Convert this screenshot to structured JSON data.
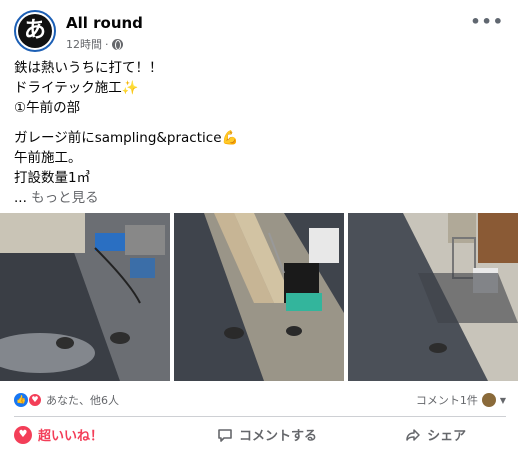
{
  "post": {
    "page_name": "All round",
    "avatar_char": "あ",
    "time": "12時間",
    "separator": "·",
    "more_icon": "more-horizontal-icon",
    "text_lines": [
      "鉄は熱いうちに打て！！",
      "ドライテック施工✨",
      "①午前の部",
      "ガレージ前にsampling&practice💪",
      "午前施工。",
      "打設数量1㎥"
    ],
    "see_more_prefix": "... ",
    "see_more": "もっと見る"
  },
  "reactions": {
    "summary": "あなた、他6人",
    "comments": "コメント1件"
  },
  "actions": {
    "love": "超いいね！",
    "comment": "コメントする",
    "share": "シェア"
  },
  "colors": {
    "love_red": "#f33e58",
    "like_blue": "#1877f2",
    "meta_gray": "#65676b"
  }
}
